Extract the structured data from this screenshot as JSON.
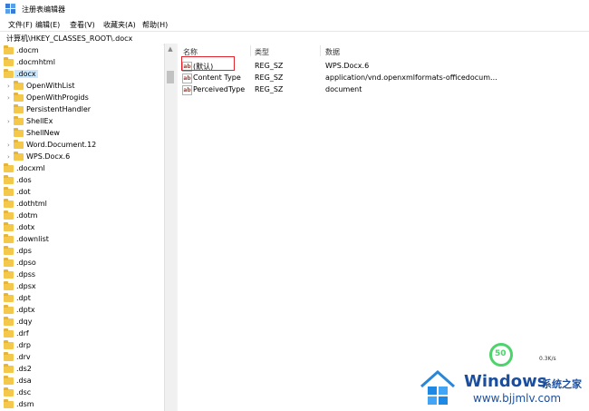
{
  "window": {
    "title": "注册表编辑器"
  },
  "menu": [
    {
      "label": "文件(F)"
    },
    {
      "label": "编辑(E)"
    },
    {
      "label": "查看(V)"
    },
    {
      "label": "收藏夹(A)"
    },
    {
      "label": "帮助(H)"
    }
  ],
  "address": "计算机\\HKEY_CLASSES_ROOT\\.docx",
  "tree": [
    {
      "label": ".docm"
    },
    {
      "label": ".docmhtml"
    },
    {
      "label": ".docx"
    },
    {
      "label": "OpenWithList"
    },
    {
      "label": "OpenWithProgids"
    },
    {
      "label": "PersistentHandler"
    },
    {
      "label": "ShellEx"
    },
    {
      "label": "ShellNew"
    },
    {
      "label": "Word.Document.12"
    },
    {
      "label": "WPS.Docx.6"
    },
    {
      "label": ".docxml"
    },
    {
      "label": ".dos"
    },
    {
      "label": ".dot"
    },
    {
      "label": ".dothtml"
    },
    {
      "label": ".dotm"
    },
    {
      "label": ".dotx"
    },
    {
      "label": ".downlist"
    },
    {
      "label": ".dps"
    },
    {
      "label": ".dpso"
    },
    {
      "label": ".dpss"
    },
    {
      "label": ".dpsx"
    },
    {
      "label": ".dpt"
    },
    {
      "label": ".dptx"
    },
    {
      "label": ".dqy"
    },
    {
      "label": ".drf"
    },
    {
      "label": ".drp"
    },
    {
      "label": ".drv"
    },
    {
      "label": ".ds2"
    },
    {
      "label": ".dsa"
    },
    {
      "label": ".dsc"
    },
    {
      "label": ".dsm"
    }
  ],
  "columns": {
    "name": "名称",
    "type": "类型",
    "data": "数据"
  },
  "values": [
    {
      "icon": "ab",
      "name": "(默认)",
      "type": "REG_SZ",
      "data": "WPS.Docx.6"
    },
    {
      "icon": "ab",
      "name": "Content Type",
      "type": "REG_SZ",
      "data": "application/vnd.openxmlformats-officedocum..."
    },
    {
      "icon": "ab",
      "name": "PerceivedType",
      "type": "REG_SZ",
      "data": "document"
    }
  ],
  "net_widget": {
    "value": "50",
    "speed": "0.3K/s"
  },
  "watermark": {
    "brand": "Windows",
    "cn": "系统之家",
    "url": "www.bjjmlv.com"
  },
  "colors": {
    "selection": "#cce8ff",
    "highlight_box": "#e0242b",
    "folder": "#f4c84a",
    "brand": "#1b4f9e",
    "net": "#4cd36a"
  }
}
